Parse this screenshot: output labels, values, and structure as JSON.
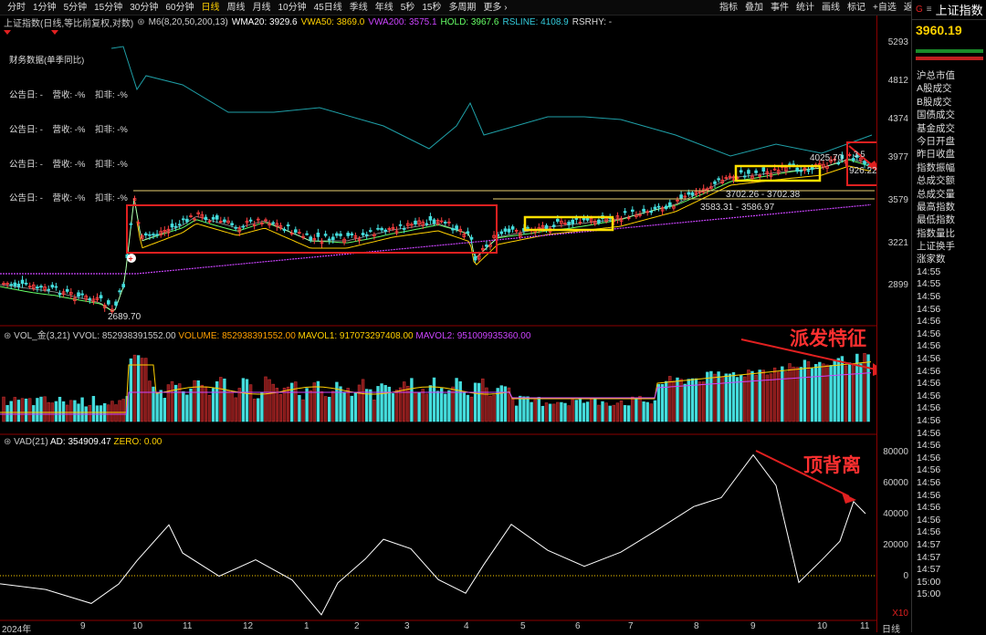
{
  "toolbar": {
    "periods": [
      "分时",
      "1分钟",
      "5分钟",
      "15分钟",
      "30分钟",
      "60分钟",
      "日线",
      "周线",
      "月线",
      "10分钟",
      "45日线",
      "季线",
      "年线",
      "5秒",
      "15秒",
      "多周期",
      "更多 ›"
    ],
    "active_index": 6,
    "tools": [
      "指标",
      "叠加",
      "事件",
      "统计",
      "画线",
      "标记",
      "+自选",
      "返回"
    ]
  },
  "indicator_line": {
    "title": "上证指数(日线,等比前复权,对数)",
    "m6": "M6(8,20,50,200,13)",
    "wma20": "WMA20: 3929.6",
    "vwa50": "VWA50: 3869.0",
    "vwa200": "VWA200: 3575.1",
    "hold": "HOLD: 3967.6",
    "rsline": "RSLINE: 4108.9",
    "rsrhy": "RSRHY: -",
    "colors": {
      "wma20": "#ffffff",
      "vwa50": "#ffd000",
      "vwa200": "#cc44ff",
      "hold": "#66ff66",
      "rsline": "#33ccdd"
    }
  },
  "finance": {
    "title": "财务数据(单季同比)",
    "row": "公告日: -    营收: -%    扣非: -%",
    "rows": 4
  },
  "price_axis": [
    "5293",
    "4812",
    "4374",
    "3977",
    "3579",
    "3221",
    "2899"
  ],
  "annotations": {
    "high": "4025.70",
    "low": "2689.70",
    "right": "926.22",
    "level1": "3702.26 - 3702.38",
    "level2": "3583.31 - 3586.97",
    "text_vol": "派发特征",
    "text_vad": "顶背离",
    "tag_small": "3.5"
  },
  "vol_line": {
    "name": "VOL_金(3,21)",
    "vvol": "VVOL: 852938391552.00",
    "volume": "VOLUME: 852938391552.00",
    "mavol1": "MAVOL1: 917073297408.00",
    "mavol2": "MAVOL2: 951009935360.00"
  },
  "vad_line": {
    "name": "VAD(21)",
    "ad": "AD: 354909.47",
    "zero": "ZERO: 0.00"
  },
  "vad_axis": [
    "80000",
    "60000",
    "40000",
    "20000",
    "0"
  ],
  "vad_unit": "X10",
  "x_axis": [
    "2024年",
    "9",
    "10",
    "11",
    "12",
    "1",
    "2",
    "3",
    "4",
    "5",
    "6",
    "7",
    "8",
    "9",
    "10",
    "11",
    "日线"
  ],
  "right_panel": {
    "brand": "G",
    "index_name": "上证指数",
    "price": "3960.19",
    "items": [
      "沪总市值",
      "A股成交",
      "B股成交",
      "国债成交",
      "基金成交",
      "今日开盘",
      "昨日收盘",
      "指数振幅",
      "总成交额",
      "总成交量",
      "最高指数",
      "最低指数",
      "指数量比",
      "上证换手",
      "涨家数"
    ],
    "times": [
      "14:55",
      "14:55",
      "14:56",
      "14:56",
      "14:56",
      "14:56",
      "14:56",
      "14:56",
      "14:56",
      "14:56",
      "14:56",
      "14:56",
      "14:56",
      "14:56",
      "14:56",
      "14:56",
      "14:56",
      "14:56",
      "14:56",
      "14:56",
      "14:56",
      "14:56",
      "14:57",
      "14:57",
      "14:57",
      "15:00",
      "15:00"
    ]
  }
}
